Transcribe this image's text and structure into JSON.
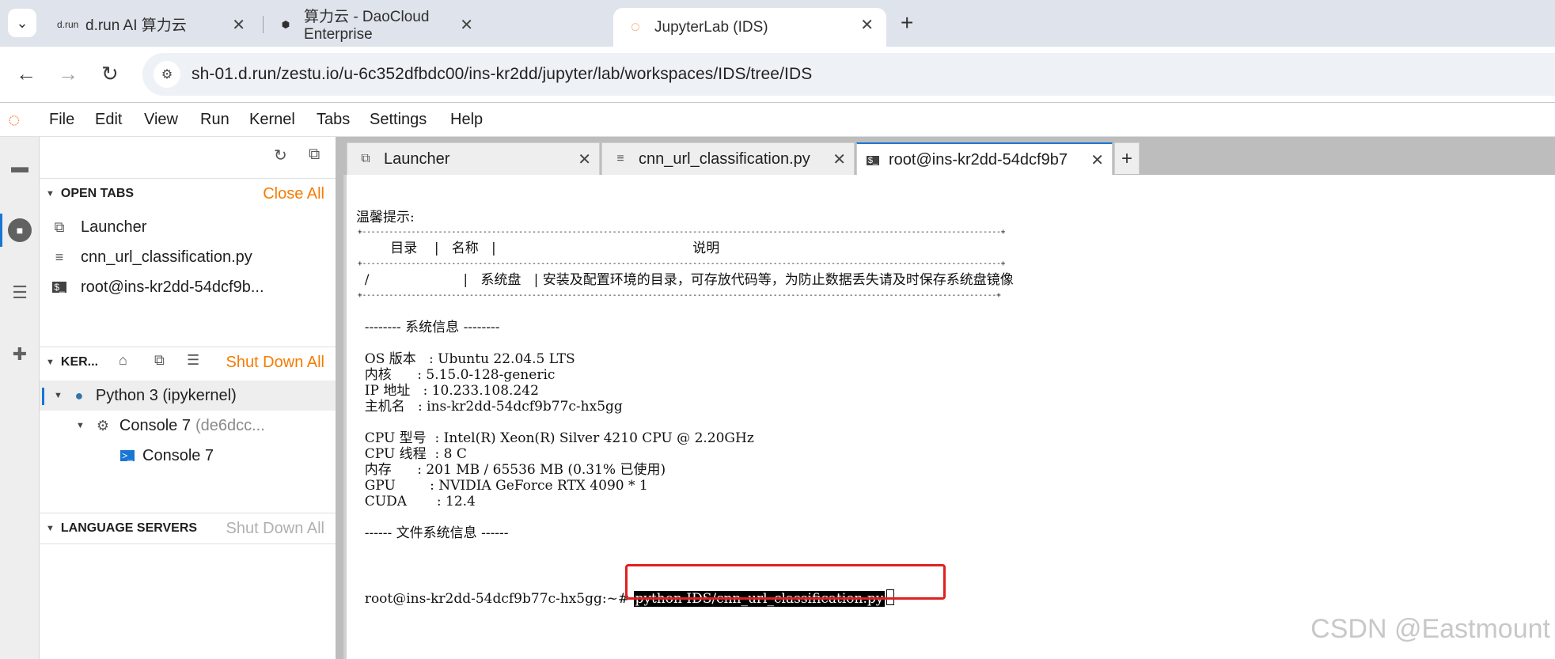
{
  "browser": {
    "tabs": [
      {
        "favicon": "d.run",
        "title": "d.run AI 算力云"
      },
      {
        "favicon": "daocloud-icon",
        "title": "算力云 - DaoCloud Enterprise"
      },
      {
        "favicon": "jupyter-icon",
        "title": "JupyterLab (IDS)"
      }
    ],
    "url": "sh-01.d.run/zestu.io/u-6c352dfbdc00/ins-kr2dd/jupyter/lab/workspaces/IDS/tree/IDS"
  },
  "menubar": {
    "items": [
      "File",
      "Edit",
      "View",
      "Run",
      "Kernel",
      "Tabs",
      "Settings",
      "Help"
    ]
  },
  "sidebar": {
    "open_tabs": {
      "header": "OPEN TABS",
      "action": "Close All",
      "items": [
        "Launcher",
        "cnn_url_classification.py",
        "root@ins-kr2dd-54dcf9b..."
      ]
    },
    "kernels": {
      "header": "KER...",
      "action": "Shut Down All",
      "kernel_name": "Python 3 (ipykernel)",
      "console_label": "Console 7",
      "console_id": "(de6dcc...",
      "console_child": "Console 7"
    },
    "language_servers": {
      "header": "LANGUAGE SERVERS",
      "action": "Shut Down All"
    }
  },
  "main_tabs": [
    {
      "label": "Launcher",
      "icon": "launcher-icon"
    },
    {
      "label": "cnn_url_classification.py",
      "icon": "file-icon"
    },
    {
      "label": "root@ins-kr2dd-54dcf9b7",
      "icon": "terminal-icon"
    }
  ],
  "terminal": {
    "tip": "温馨提示:",
    "border1": "+-----------------------------------------------------------------------------------------------------------------------------------------------+",
    "table_header": "        目录    |   名称   |                                              说明",
    "border2": "+-----------------------------------------------------------------------------------------------------------------------------------------------+",
    "table_row": "  /                      |   系统盘   | 安装及配置环境的目录，可存放代码等，为防止数据丢失请及时保存系统盘镜像",
    "border3": "+----------------------------------------------------------------------------------------------------------------------------------------------+",
    "sysinfo_title": "  -------- 系统信息 --------",
    "os": "  OS 版本   : Ubuntu 22.04.5 LTS",
    "kernel": "  内核      : 5.15.0-128-generic",
    "ip": "  IP 地址   : 10.233.108.242",
    "hostname": "  主机名   : ins-kr2dd-54dcf9b77c-hx5gg",
    "cpu_model": "  CPU 型号  : Intel(R) Xeon(R) Silver 4210 CPU @ 2.20GHz",
    "cpu_threads": "  CPU 线程  : 8 C",
    "memory": "  内存      : 201 MB / 65536 MB (0.31% 已使用)",
    "gpu": "  GPU        : NVIDIA GeForce RTX 4090 * 1",
    "cuda": "  CUDA       : 12.4",
    "fsinfo_title": "  ------ 文件系统信息 ------",
    "prompt": "root@ins-kr2dd-54dcf9b77c-hx5gg:~# ",
    "command": "python IDS/cnn_url_classification.py"
  },
  "watermark": "CSDN @Eastmount",
  "colors": {
    "accent": "#f57c00",
    "active_blue": "#1976d2",
    "highlight_box": "#e02020"
  }
}
